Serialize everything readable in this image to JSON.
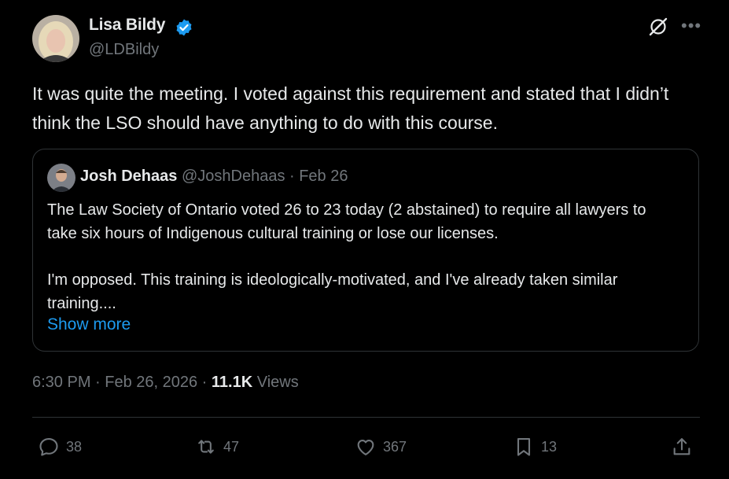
{
  "author": {
    "name": "Lisa Bildy",
    "handle": "@LDBildy",
    "verified": true
  },
  "tweet_text": "It was quite the meeting. I voted against this requirement and stated that I didn’t think the LSO should have anything to do with this course.",
  "quote": {
    "name": "Josh Dehaas",
    "handle": "@JoshDehaas",
    "date": "· Feb 26",
    "paragraph1": "The Law Society of Ontario voted 26 to 23 today (2 abstained) to require all lawyers to take six hours of Indigenous cultural training or lose our licenses.",
    "paragraph2": "I'm opposed. This training is ideologically-motivated, and I've already taken similar training....",
    "show_more": "Show more"
  },
  "meta": {
    "time": "6:30 PM · Feb 26, 2026 ·",
    "views_count": "11.1K",
    "views_label": "Views"
  },
  "actions": {
    "replies": "38",
    "reposts": "47",
    "likes": "367",
    "bookmarks": "13"
  },
  "colors": {
    "background": "#000000",
    "text": "#e7e9ea",
    "muted": "#71767b",
    "accent": "#1d9bf0",
    "border": "#2f3336"
  },
  "icons": [
    "verified-badge-icon",
    "grok-icon",
    "more-icon",
    "reply-icon",
    "repost-icon",
    "like-icon",
    "bookmark-icon",
    "share-icon"
  ]
}
